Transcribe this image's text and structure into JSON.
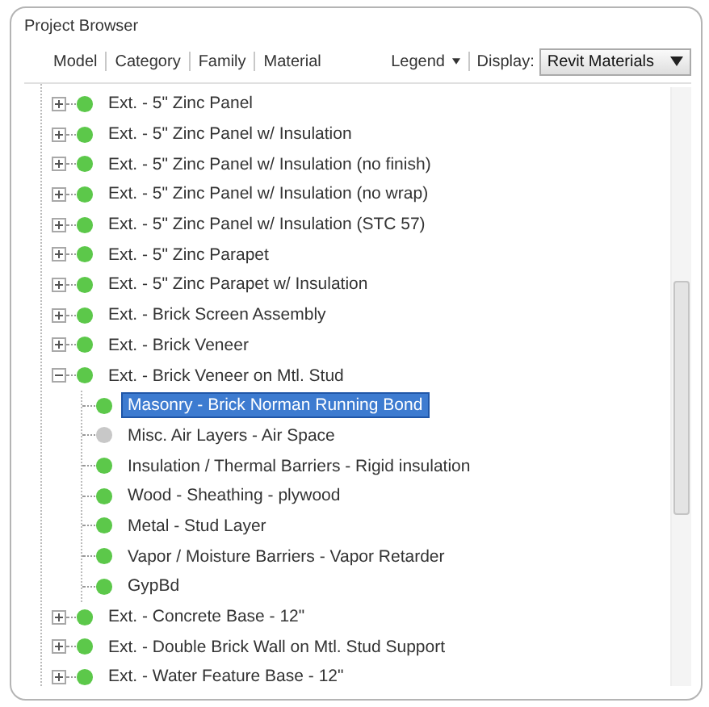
{
  "window": {
    "title": "Project Browser"
  },
  "toolbar": {
    "tabs": [
      {
        "label": "Model"
      },
      {
        "label": "Category"
      },
      {
        "label": "Family"
      },
      {
        "label": "Material"
      }
    ],
    "legend": "Legend",
    "display_label": "Display:",
    "display_value": "Revit Materials"
  },
  "tree": [
    {
      "label": "Ext. - 5\" Zinc Panel",
      "expanded": false,
      "color": "#5cc84a"
    },
    {
      "label": "Ext. - 5\" Zinc Panel w/ Insulation",
      "expanded": false,
      "color": "#5cc84a"
    },
    {
      "label": "Ext. - 5\" Zinc Panel w/ Insulation (no finish)",
      "expanded": false,
      "color": "#5cc84a"
    },
    {
      "label": "Ext. - 5\" Zinc Panel w/ Insulation (no wrap)",
      "expanded": false,
      "color": "#5cc84a"
    },
    {
      "label": "Ext. - 5\" Zinc Panel w/ Insulation (STC 57)",
      "expanded": false,
      "color": "#5cc84a"
    },
    {
      "label": "Ext. - 5\" Zinc Parapet",
      "expanded": false,
      "color": "#5cc84a"
    },
    {
      "label": "Ext. - 5\" Zinc Parapet w/ Insulation",
      "expanded": false,
      "color": "#5cc84a"
    },
    {
      "label": "Ext. - Brick Screen Assembly",
      "expanded": false,
      "color": "#5cc84a"
    },
    {
      "label": "Ext. - Brick Veneer",
      "expanded": false,
      "color": "#5cc84a"
    },
    {
      "label": "Ext. - Brick Veneer on Mtl. Stud",
      "expanded": true,
      "color": "#5cc84a",
      "children": [
        {
          "label": "Masonry - Brick Norman Running Bond",
          "selected": true,
          "color": "#5cc84a"
        },
        {
          "label": "Misc. Air Layers - Air Space",
          "selected": false,
          "color": "#c8c8c8"
        },
        {
          "label": "Insulation / Thermal Barriers - Rigid insulation",
          "selected": false,
          "color": "#5cc84a"
        },
        {
          "label": "Wood - Sheathing - plywood",
          "selected": false,
          "color": "#5cc84a"
        },
        {
          "label": "Metal - Stud Layer",
          "selected": false,
          "color": "#5cc84a"
        },
        {
          "label": "Vapor / Moisture Barriers - Vapor Retarder",
          "selected": false,
          "color": "#5cc84a"
        },
        {
          "label": "GypBd",
          "selected": false,
          "color": "#5cc84a"
        }
      ]
    },
    {
      "label": "Ext. - Concrete Base - 12\"",
      "expanded": false,
      "color": "#5cc84a"
    },
    {
      "label": "Ext. - Double Brick Wall on Mtl. Stud Support",
      "expanded": false,
      "color": "#5cc84a"
    },
    {
      "label": "Ext. - Water Feature  Base - 12\"",
      "expanded": false,
      "color": "#5cc84a"
    }
  ]
}
